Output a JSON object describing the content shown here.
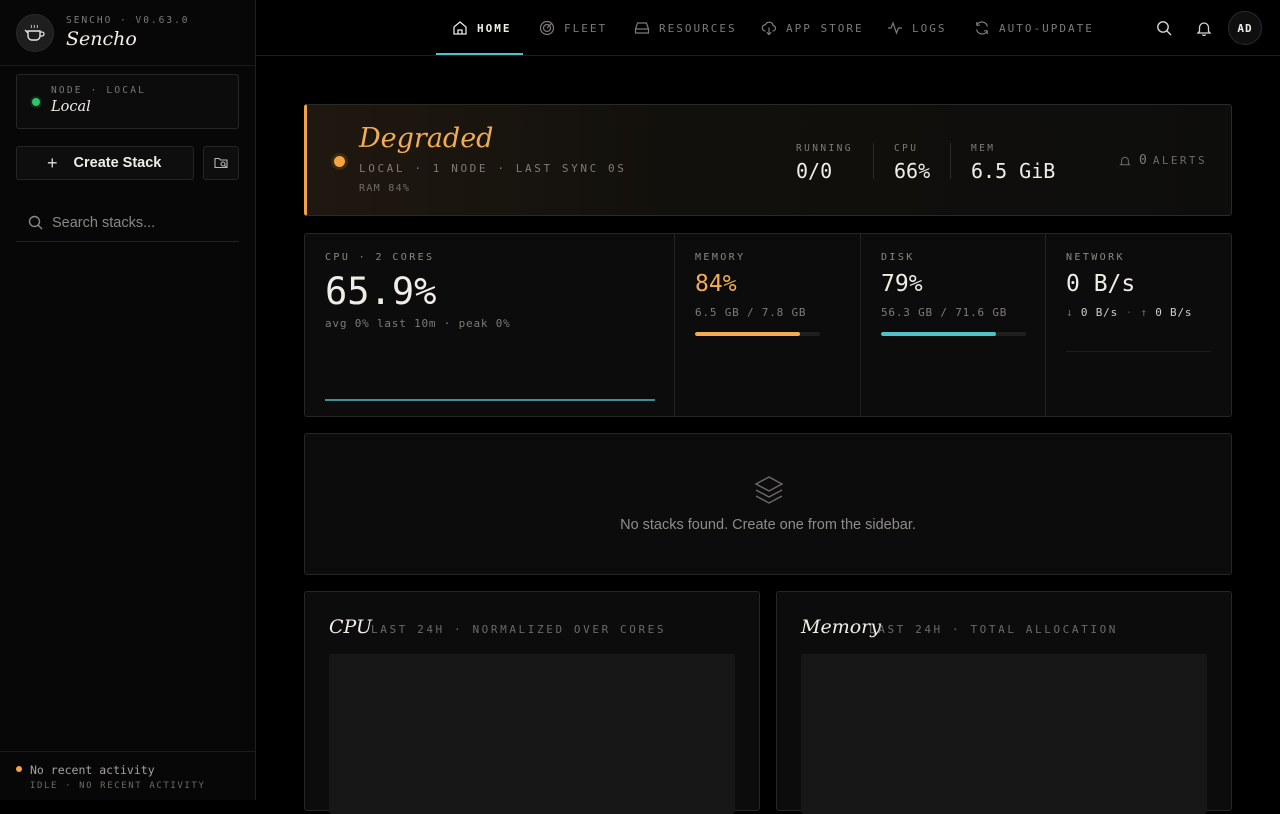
{
  "brand": {
    "version": "SENCHO · V0.63.0",
    "name": "Sencho"
  },
  "node": {
    "label": "NODE · LOCAL",
    "name": "Local",
    "status_color": "#2fc46a"
  },
  "sidebar": {
    "create_label": "Create Stack",
    "search_placeholder": "Search stacks..."
  },
  "activity": {
    "main": "No recent activity",
    "sub": "IDLE · NO RECENT ACTIVITY"
  },
  "nav": {
    "tabs": [
      {
        "label": "HOME",
        "icon": "home-icon"
      },
      {
        "label": "FLEET",
        "icon": "radar-icon"
      },
      {
        "label": "RESOURCES",
        "icon": "hard-drive-icon"
      },
      {
        "label": "APP STORE",
        "icon": "cloud-download-icon"
      },
      {
        "label": "LOGS",
        "icon": "activity-icon"
      },
      {
        "label": "AUTO-UPDATE",
        "icon": "refresh-icon"
      }
    ],
    "active_tab": "HOME",
    "avatar": "AD"
  },
  "status": {
    "title": "Degraded",
    "subtitle": "LOCAL · 1 NODE · LAST SYNC 0S",
    "ram": "RAM 84%",
    "running_label": "RUNNING",
    "running_value": "0/0",
    "cpu_label": "CPU",
    "cpu_value": "66%",
    "mem_label": "MEM",
    "mem_value": "6.5 GiB",
    "alerts_count": "0",
    "alerts_label": "ALERTS",
    "accent": "#f0a245"
  },
  "metrics": {
    "cpu": {
      "label": "CPU · 2 CORES",
      "value": "65.9%",
      "sub": "avg 0% last 10m · peak 0%"
    },
    "memory": {
      "label": "MEMORY",
      "value": "84%",
      "sub": "6.5 GB / 7.8 GB",
      "fill_pct": 84,
      "color": "#f3ac52"
    },
    "disk": {
      "label": "DISK",
      "value": "79%",
      "sub": "56.3 GB / 71.6 GB",
      "fill_pct": 79,
      "color": "#4fc2c7"
    },
    "network": {
      "label": "NETWORK",
      "value": "0 B/s",
      "down": "0 B/s",
      "up": "0 B/s"
    }
  },
  "empty": {
    "message": "No stacks found. Create one from the sidebar."
  },
  "charts": {
    "cpu": {
      "title": "CPU",
      "subtitle": "LAST 24H · NORMALIZED OVER CORES"
    },
    "memory": {
      "title": "Memory",
      "subtitle": "LAST 24H · TOTAL ALLOCATION"
    }
  }
}
